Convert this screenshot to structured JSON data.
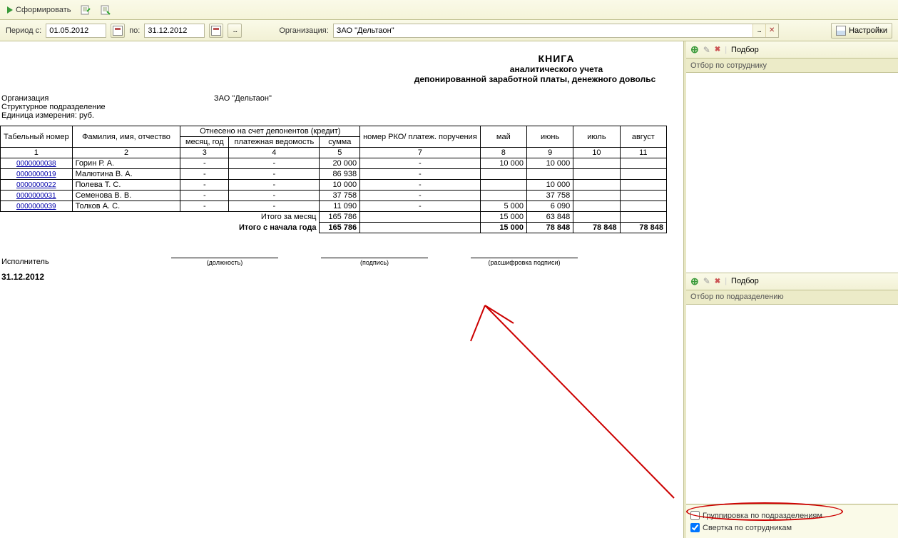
{
  "toolbar": {
    "form_label": "Сформировать"
  },
  "params": {
    "period_label": "Период с:",
    "period_from": "01.05.2012",
    "to_label": "по:",
    "period_to": "31.12.2012",
    "org_label": "Организация:",
    "org_value": "ЗАО \"Дельтаон\"",
    "settings_label": "Настройки"
  },
  "report": {
    "title1": "КНИГА",
    "title2": "аналитического учета",
    "title3": "депонированной заработной платы, денежного довольс",
    "org_label": "Организация",
    "org_value": "ЗАО \"Дельтаон\"",
    "unit_label": "Структурное подразделение",
    "unit_value": "",
    "measure_label": "Единица измерения: руб.",
    "columns": {
      "tabnum": "Табельный номер",
      "fio": "Фамилия, имя, отчество",
      "credit_group": "Отнесено на счет депонентов (кредит)",
      "month": "месяц, год",
      "vedom": "платежная ведомость",
      "sum": "сумма",
      "rko": "номер РКО/ платеж. поручения",
      "may": "май",
      "jun": "июнь",
      "jul": "июль",
      "aug": "август"
    },
    "colnums": [
      "1",
      "2",
      "3",
      "4",
      "5",
      "7",
      "8",
      "9",
      "10",
      "11"
    ],
    "rows": [
      {
        "num": "0000000038",
        "name": "Горин Р. А.",
        "m": "-",
        "v": "-",
        "s": "20 000",
        "rko": "-",
        "may": "10 000",
        "jun": "10 000",
        "jul": "",
        "aug": ""
      },
      {
        "num": "0000000019",
        "name": "Малютина В. А.",
        "m": "-",
        "v": "-",
        "s": "86 938",
        "rko": "-",
        "may": "",
        "jun": "",
        "jul": "",
        "aug": ""
      },
      {
        "num": "0000000022",
        "name": "Полева Т. С.",
        "m": "-",
        "v": "-",
        "s": "10 000",
        "rko": "-",
        "may": "",
        "jun": "10 000",
        "jul": "",
        "aug": ""
      },
      {
        "num": "0000000031",
        "name": "Семенова В. В.",
        "m": "-",
        "v": "-",
        "s": "37 758",
        "rko": "-",
        "may": "",
        "jun": "37 758",
        "jul": "",
        "aug": ""
      },
      {
        "num": "0000000039",
        "name": "Толков А. С.",
        "m": "-",
        "v": "-",
        "s": "11 090",
        "rko": "-",
        "may": "5 000",
        "jun": "6 090",
        "jul": "",
        "aug": ""
      }
    ],
    "total_month_label": "Итого за месяц",
    "total_month": {
      "s": "165 786",
      "may": "15 000",
      "jun": "63 848",
      "jul": "",
      "aug": ""
    },
    "total_year_label": "Итого с начала года",
    "total_year": {
      "s": "165 786",
      "may": "15 000",
      "jun": "78 848",
      "jul": "78 848",
      "aug": "78 848"
    },
    "exec_label": "Исполнитель",
    "sig_post": "(должность)",
    "sig_sign": "(подпись)",
    "sig_name": "(расшифровка подписи)",
    "date": "31.12.2012"
  },
  "sidebar": {
    "select_label": "Подбор",
    "filter_emp": "Отбор по сотруднику",
    "filter_dept": "Отбор по подразделению",
    "group_dept": "Группировка по подразделениям",
    "collapse_emp": "Свертка по сотрудникам"
  }
}
